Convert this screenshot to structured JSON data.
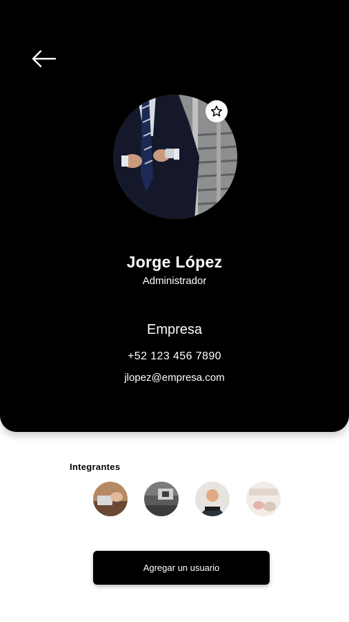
{
  "profile": {
    "name": "Jorge López",
    "role": "Administrador",
    "company": "Empresa",
    "phone": "+52 123 456 7890",
    "email": "jlopez@empresa.com",
    "photo_icon": "person-in-suit-photo"
  },
  "icons": {
    "back": "arrow-left-icon",
    "favorite": "star-outline-icon"
  },
  "members": {
    "title": "Integrantes",
    "items": [
      {
        "photo": "member-photo-1"
      },
      {
        "photo": "member-photo-2"
      },
      {
        "photo": "member-photo-3"
      },
      {
        "photo": "member-photo-4"
      }
    ]
  },
  "actions": {
    "add_user_label": "Agregar un usuario"
  },
  "colors": {
    "card_background": "#000000",
    "page_background": "#ffffff",
    "text_on_card": "#ffffff",
    "button_background": "#000000"
  }
}
